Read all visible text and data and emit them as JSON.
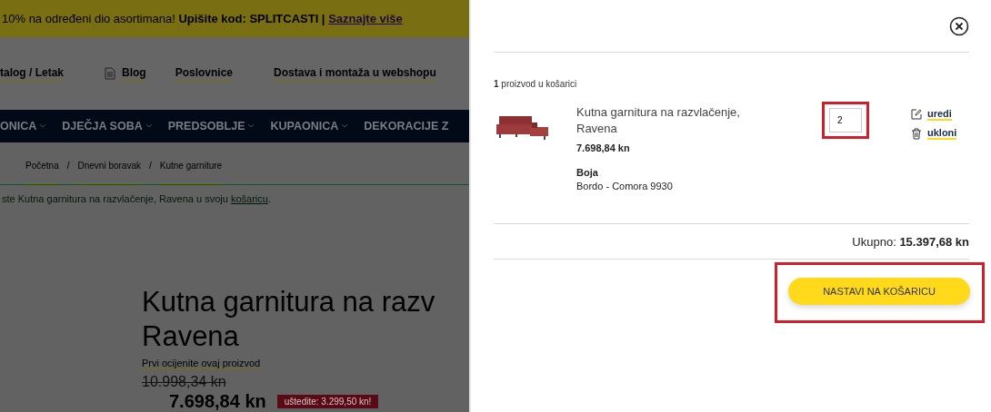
{
  "promo_banner": {
    "text": "10% na određeni dio asortimana! **Upišite kod: SPLITCASTI |**",
    "link": "Saznajte više"
  },
  "header_links": [
    {
      "label": "talog / Letak",
      "kind": "text"
    },
    {
      "label": "Blog",
      "kind": "icon"
    },
    {
      "label": "Poslovnice",
      "kind": "text"
    },
    {
      "label": "Dostava i montaža u webshopu",
      "kind": "text"
    }
  ],
  "nav": [
    "ONICA",
    "DJEČJA SOBA",
    "PREDSOBLJE",
    "KUPAONICA",
    "DEKORACIJE Z"
  ],
  "breadcrumb": [
    "Početna",
    "Dnevni boravak",
    "Kutne garniture"
  ],
  "breadcrumb_separator": "/",
  "success_message": {
    "text": "ste Kutna garnitura na razvlačenje, Ravena u svoju",
    "link": "košaricu",
    "end": "."
  },
  "product": {
    "title": [
      "Kutna garnitura na razv",
      "Ravena"
    ],
    "rating_link": "Prvi ocijenite ovaj proizvod",
    "old_price": "10.998,34 kn",
    "price": "7.698,84 kn",
    "savings": "uštedite: 3.299,50 kn!"
  },
  "cart": {
    "count": "1",
    "count_label": "proizvod u košarici",
    "items": [
      {
        "name": "Kutna garnitura na razvlačenje, Ravena",
        "price": "7.698,84 kn",
        "attribute_label": "Boja",
        "attribute_value": "Bordo - Comora 9930",
        "quantity": "2",
        "quantity_highlighted": true,
        "actions": [
          {
            "kind": "edit",
            "label": "uredi"
          },
          {
            "kind": "remove",
            "label": "ukloni"
          }
        ]
      }
    ],
    "total_label": "Ukupno:",
    "total": "15.397,68 kn",
    "checkout_button": "NASTAVI NA KOŠARICU",
    "checkout_highlighted": true
  }
}
